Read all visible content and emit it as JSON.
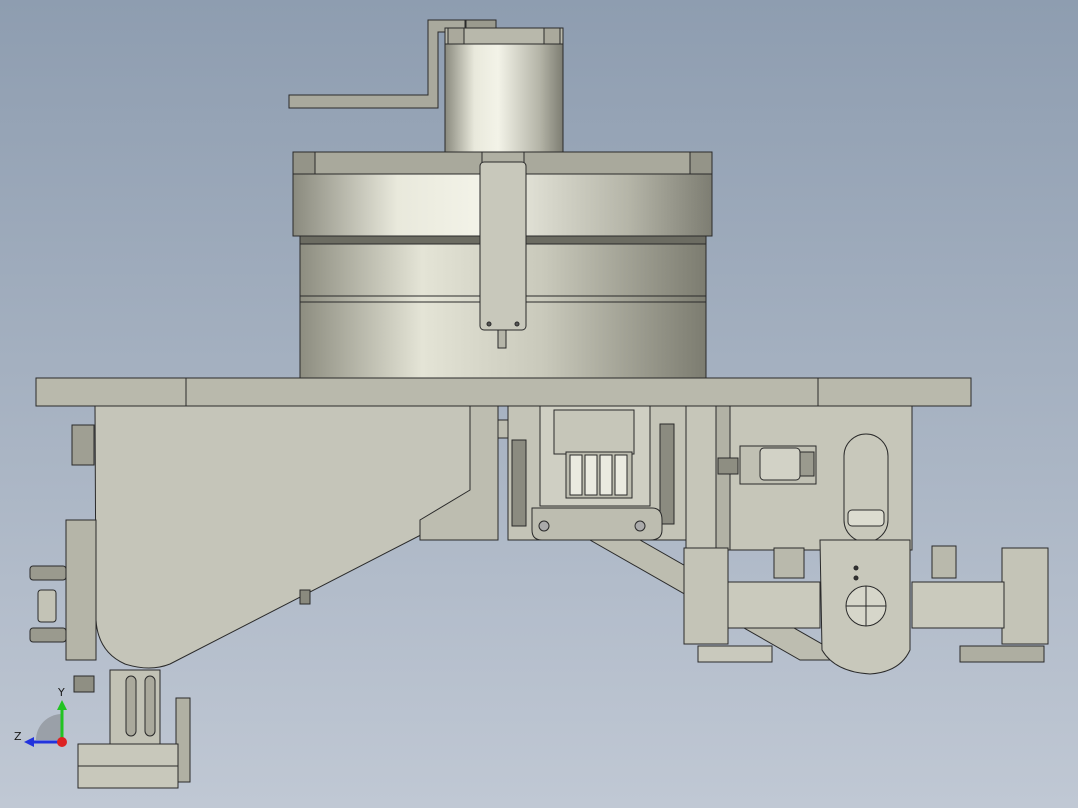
{
  "view": {
    "title": "",
    "background_top": "#8e9db0",
    "background_bottom": "#c0c8d4"
  },
  "model": {
    "description_icon": "cad-assembly-front-view",
    "face_color": "#c9c9bd",
    "edge_color": "#2a2a2a"
  },
  "triad": {
    "y_label": "Y",
    "z_label": "Z",
    "y_color": "#22c322",
    "z_color": "#2233dd",
    "x_color": "#dd2222"
  }
}
